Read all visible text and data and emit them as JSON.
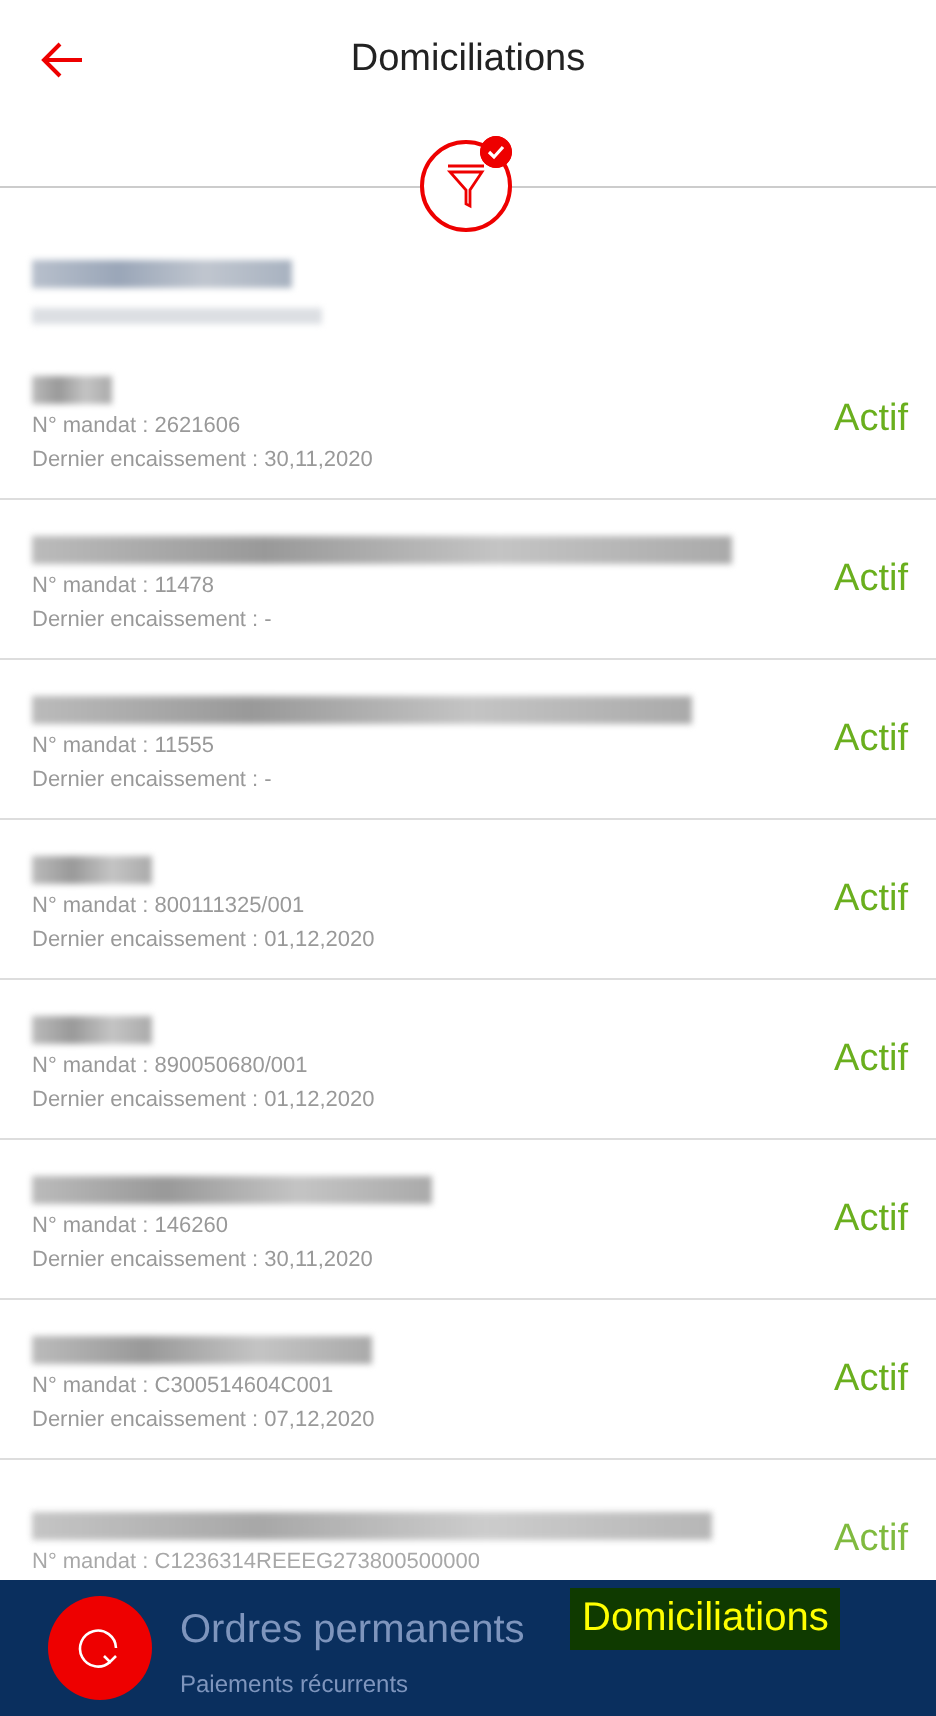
{
  "header": {
    "title": "Domiciliations"
  },
  "filter": {
    "active": true
  },
  "mandates": [
    {
      "mandate": "N° mandat : 2621606",
      "last": "Dernier encaissement : 30,11,2020",
      "status": "Actif"
    },
    {
      "mandate": "N° mandat : 11478",
      "last": "Dernier encaissement : -",
      "status": "Actif"
    },
    {
      "mandate": "N° mandat : 11555",
      "last": "Dernier encaissement : -",
      "status": "Actif"
    },
    {
      "mandate": "N° mandat : 800111325/001",
      "last": "Dernier encaissement : 01,12,2020",
      "status": "Actif"
    },
    {
      "mandate": "N° mandat : 890050680/001",
      "last": "Dernier encaissement : 01,12,2020",
      "status": "Actif"
    },
    {
      "mandate": "N° mandat : 146260",
      "last": "Dernier encaissement : 30,11,2020",
      "status": "Actif"
    },
    {
      "mandate": "N° mandat : C300514604C001",
      "last": "Dernier encaissement : 07,12,2020",
      "status": "Actif"
    },
    {
      "mandate": "N° mandat : C1236314REEEG273800500000",
      "status": "Actif"
    }
  ],
  "bottom_bar": {
    "title": "Ordres permanents",
    "subtitle": "Paiements récurrents",
    "highlight": "Domiciliations"
  }
}
